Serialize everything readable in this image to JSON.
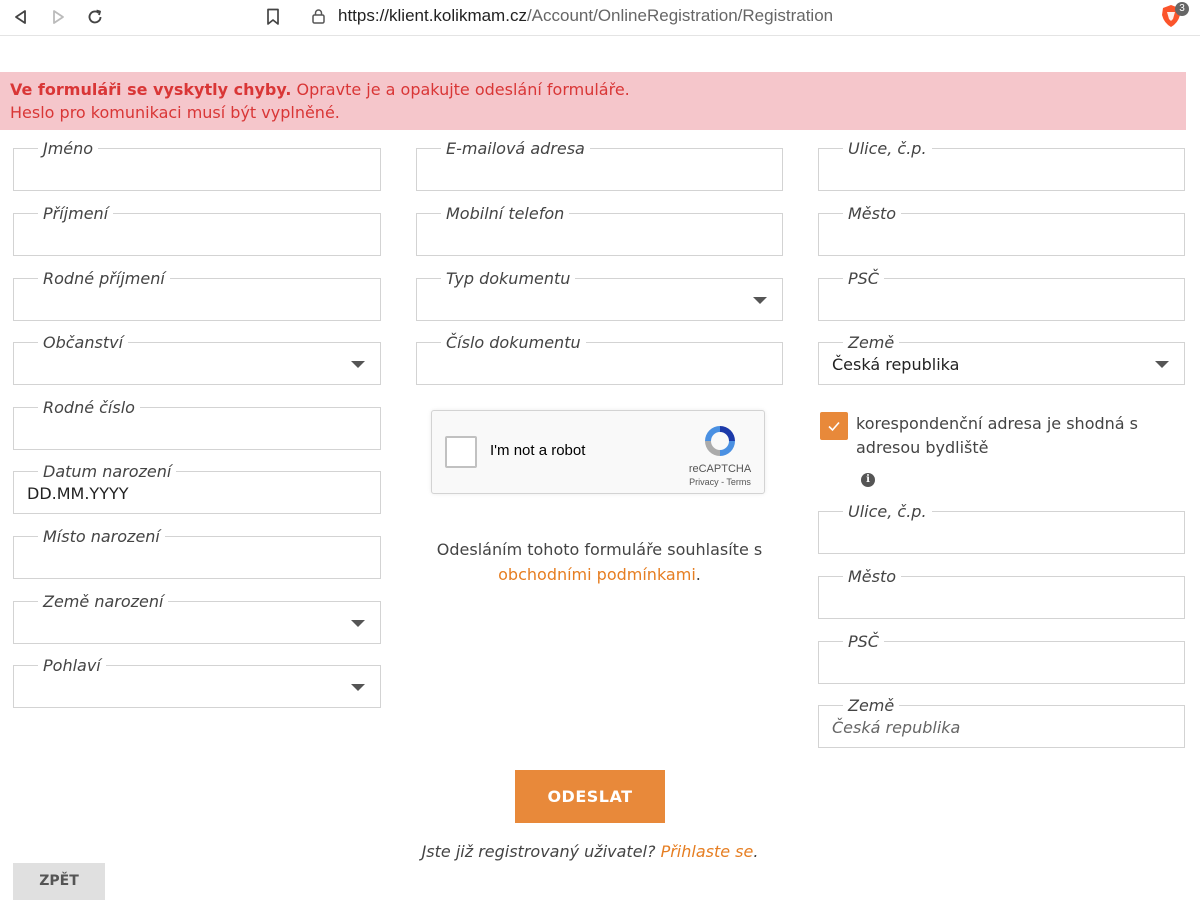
{
  "browser": {
    "url_host": "https://klient.kolikmam.cz",
    "url_path": "/Account/OnlineRegistration/Registration",
    "shield_badge": "3"
  },
  "error": {
    "title": "Ve formuláři se vyskytly chyby.",
    "message": " Opravte je a opakujte odeslání formuláře.",
    "detail": "Heslo pro komunikaci musí být vyplněné."
  },
  "form": {
    "left": {
      "jmeno": {
        "label": "Jméno",
        "value": ""
      },
      "prijmeni": {
        "label": "Příjmení",
        "value": ""
      },
      "rodne_prijmeni": {
        "label": "Rodné příjmení",
        "value": ""
      },
      "obcanstvi": {
        "label": "Občanství",
        "value": ""
      },
      "rodne_cislo": {
        "label": "Rodné číslo",
        "value": ""
      },
      "datum_narozeni": {
        "label": "Datum narození",
        "value": "DD.MM.YYYY"
      },
      "misto_narozeni": {
        "label": "Místo narození",
        "value": ""
      },
      "zeme_narozeni": {
        "label": "Země narození",
        "value": ""
      },
      "pohlavi": {
        "label": "Pohlaví",
        "value": ""
      }
    },
    "middle": {
      "email": {
        "label": "E-mailová adresa",
        "value": ""
      },
      "telefon": {
        "label": "Mobilní telefon",
        "value": ""
      },
      "typ_dokumentu": {
        "label": "Typ dokumentu",
        "value": ""
      },
      "cislo_dokumentu": {
        "label": "Číslo dokumentu",
        "value": ""
      }
    },
    "right": {
      "ulice": {
        "label": "Ulice, č.p.",
        "value": ""
      },
      "mesto": {
        "label": "Město",
        "value": ""
      },
      "psc": {
        "label": "PSČ",
        "value": ""
      },
      "zeme": {
        "label": "Země",
        "value": "Česká republika"
      },
      "same_address_label": "korespondenční adresa je shodná s adresou bydliště",
      "same_address_checked": true,
      "kor_ulice": {
        "label": "Ulice, č.p.",
        "value": ""
      },
      "kor_mesto": {
        "label": "Město",
        "value": ""
      },
      "kor_psc": {
        "label": "PSČ",
        "value": ""
      },
      "kor_zeme": {
        "label": "Země",
        "placeholder": "Česká republika"
      }
    }
  },
  "recaptcha": {
    "label": "I'm not a robot",
    "brand": "reCAPTCHA",
    "links": "Privacy - Terms"
  },
  "consent": {
    "text": "Odesláním tohoto formuláře souhlasíte s ",
    "link": "obchodními podmínkami",
    "end": "."
  },
  "actions": {
    "submit": "ODESLAT",
    "login_question": "Jste již registrovaný uživatel? ",
    "login_link": "Přihlaste se",
    "login_end": ".",
    "back": "ZPĚT"
  },
  "colors": {
    "accent": "#e8893a",
    "error_bg": "#f5c6cb",
    "error_text": "#d93636"
  }
}
